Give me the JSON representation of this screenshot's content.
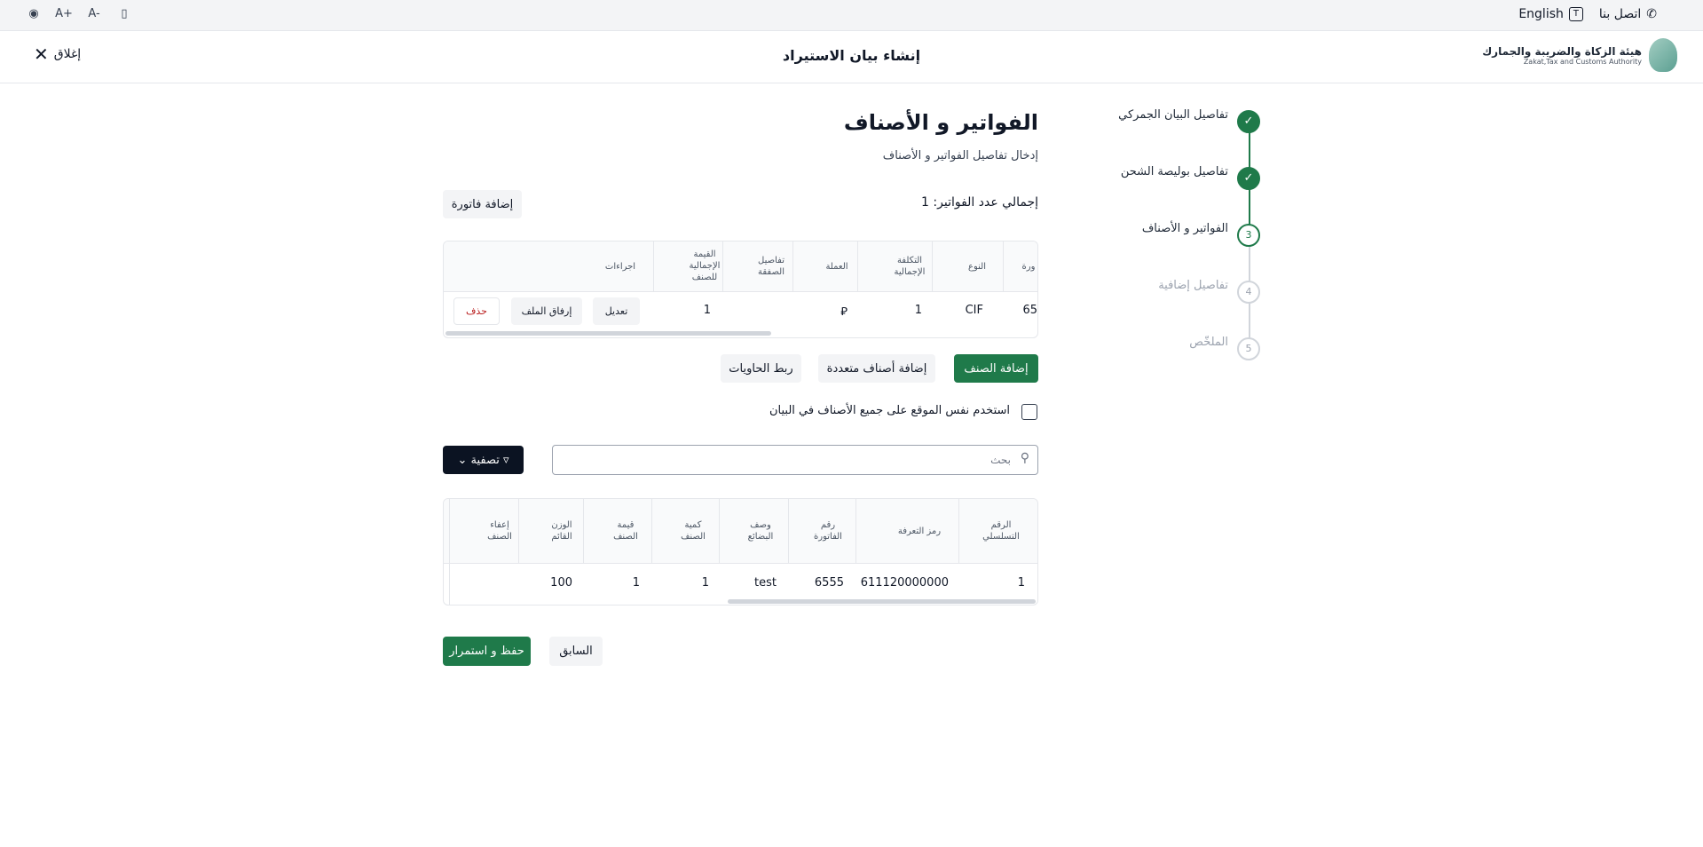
{
  "topbar": {
    "contact_label": "اتصل بنا",
    "language_label": "English",
    "font_increase": "A+",
    "font_decrease": "A-"
  },
  "header": {
    "logo_ar": "هيئة الزكاة والضريبة والجمارك",
    "logo_en": "Zakat,Tax and Customs Authority",
    "title": "إنشاء بيان الاستيراد",
    "close_label": "إغلاق"
  },
  "stepper": {
    "steps": [
      {
        "number": "1",
        "label": "تفاصيل البيان الجمركي",
        "status": "done"
      },
      {
        "number": "2",
        "label": "تفاصيل بوليصة الشحن",
        "status": "done"
      },
      {
        "number": "3",
        "label": "الفواتير و الأصناف",
        "status": "active"
      },
      {
        "number": "4",
        "label": "تفاصيل إضافية",
        "status": "todo"
      },
      {
        "number": "5",
        "label": "الملخّص",
        "status": "todo"
      }
    ]
  },
  "main": {
    "title": "الفواتير و الأصناف",
    "subtitle": "إدخال تفاصيل الفواتير و الأصناف",
    "total_invoices": "إجمالي عدد الفواتير: 1",
    "add_invoice_label": "إضافة فاتورة"
  },
  "invoice_table": {
    "headers": {
      "invoice": "ورة",
      "type": "النوع",
      "total_cost": "التكلفة الإجمالية",
      "currency": "العملة",
      "deal_details": "تفاصيل الصفقة",
      "total_value": "القيمة الإجمالية للصنف",
      "actions": "اجراءات"
    },
    "row": {
      "invoice": "65",
      "type": "CIF",
      "total_cost": "1",
      "currency": "⃁",
      "deal_details": "",
      "total_value": "1",
      "edit_label": "تعديل",
      "attach_label": "إرفاق الملف",
      "delete_label": "حذف"
    }
  },
  "item_actions": {
    "add_item_label": "إضافة الصنف",
    "add_multiple_label": "إضافة أصناف متعددة",
    "link_containers_label": "ربط الحاويات",
    "same_location_label": "استخدم نفس الموقع على جميع الأصناف في البيان"
  },
  "filter": {
    "search_placeholder": "بحث",
    "filter_label": "تصفية"
  },
  "items_table": {
    "headers": {
      "serial": "الرقم التسلسلي",
      "tariff": "رمز التعرفة",
      "invoice_no": "رقم الفاتورة",
      "goods_desc": "وصف البضائع",
      "item_qty": "كمية الصنف",
      "item_value": "قيمة الصنف",
      "gross_weight": "الوزن القائم",
      "exemption": "إعفاء الصنف"
    },
    "rows": [
      {
        "serial": "1",
        "tariff": "611120000000",
        "invoice_no": "6555",
        "goods_desc": "test",
        "item_qty": "1",
        "item_value": "1",
        "gross_weight": "100",
        "exemption": ""
      }
    ]
  },
  "footer": {
    "save_continue_label": "حفظ و استمرار",
    "previous_label": "السابق"
  },
  "colors": {
    "primary_green": "#1f7a4a",
    "dark_button": "#0b1322",
    "delete_red": "#b91c1c"
  }
}
